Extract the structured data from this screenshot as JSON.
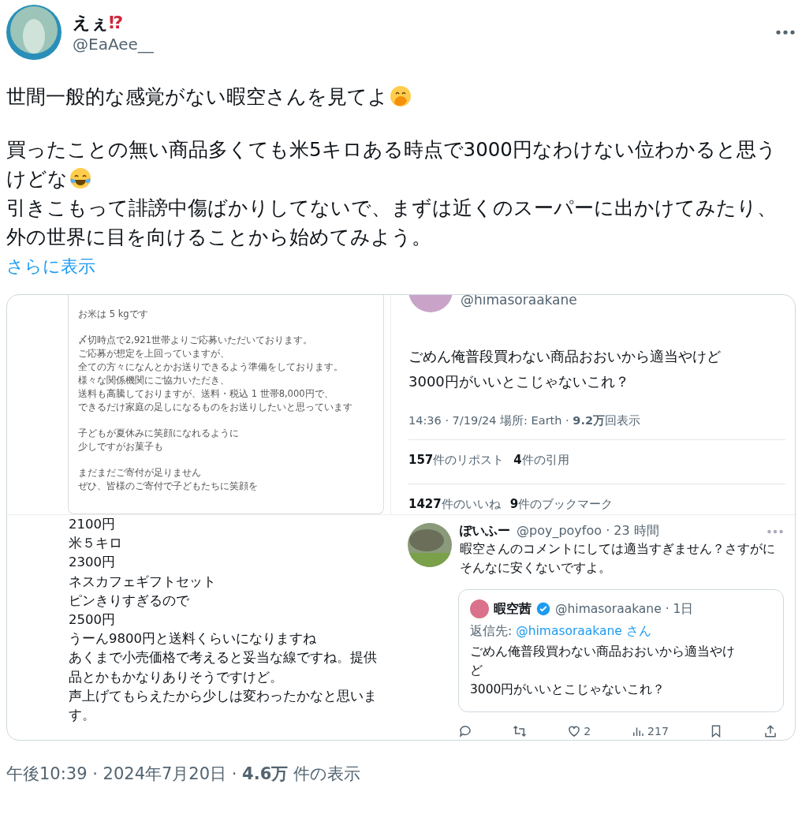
{
  "author": {
    "name": "えぇ",
    "mark": "⁉",
    "handle": "@EaAee__"
  },
  "paragraphs": [
    [
      {
        "text": "世間一般的な感覚がない暇空さんを見てよ",
        "kind": "emoji_end"
      }
    ],
    [
      {
        "text": "買ったことの無い商品多くても米5キロある時点で3000円なわけない位わかると思うけどな",
        "kind": "emoji_end"
      },
      {
        "text": "引きこもって誹謗中傷ばかりしてないで、まずは近くのスーパーに出かけてみたり、外の世界に目を向けることから始めてみよう。",
        "kind": "plain"
      }
    ]
  ],
  "show_more": "さらに表示",
  "media": [
    {
      "kind": "notice",
      "paragraphs": [
        [
          "お米は 5 kgです"
        ],
        [
          "〆切時点で2,921世帯よりご応募いただいております。",
          "ご応募が想定を上回っていますが、",
          "全ての方々になんとかお送りできるよう準備をしております。",
          "様々な関係機関にご協力いただき、",
          "送料も高騰しておりますが、送料・税込 1 世帯8,000円で、",
          "できるだけ家庭の足しになるものをお送りしたいと思っています"
        ],
        [
          "子どもが夏休みに笑顔になれるように",
          "少しですがお菓子も"
        ],
        [
          "まだまだご寄付が足りません",
          "ぜひ、皆様のご寄付で子どもたちに笑顔を"
        ]
      ]
    },
    {
      "kind": "tweet",
      "handle": "@himasoraakane",
      "lines": [
        "ごめん俺普段買わない商品おおいから適当やけど",
        "3000円がいいとこじゃないこれ？"
      ],
      "meta": "14:36 · 7/19/24 場所: Earth · **9.2万**回表示",
      "stat_rows": [
        [
          {
            "count": "157",
            "label": "件のリポスト"
          },
          {
            "count": "4",
            "label": "件の引用"
          }
        ],
        [
          {
            "count": "1427",
            "label": "件のいいね"
          },
          {
            "count": "9",
            "label": "件のブックマーク"
          }
        ]
      ]
    },
    {
      "kind": "memo",
      "lines": [
        "2100円",
        "米５キロ",
        "2300円",
        "ネスカフェギフトセット",
        "ピンきりすぎるので",
        "2500円",
        "うーん9800円と送料くらいになりますね",
        "あくまで小売価格で考えると妥当な線ですね。提供品とかもかなりありそうですけど。",
        "声上げてもらえたから少しは変わったかなと思います。"
      ]
    },
    {
      "kind": "reply",
      "name": "ぽいふー",
      "handle": "@poy_poyfoo · 23 時間",
      "text": "暇空さんのコメントにしては適当すぎません？さすがにそんなに安くないですよ。",
      "quote": {
        "name": "暇空茜",
        "verified": true,
        "handle": "@himasoraakane · 1日",
        "reply_label": "返信先:",
        "reply_to": "@himasoraakane さん",
        "lines": [
          "ごめん俺普段買わない商品おおいから適当やけ",
          "ど",
          "3000円がいいとこじゃないこれ？"
        ]
      },
      "actions": [
        {
          "kind": "reply"
        },
        {
          "kind": "repost"
        },
        {
          "kind": "like",
          "count": "2"
        },
        {
          "kind": "views",
          "count": "217"
        },
        {
          "kind": "bookmark"
        },
        {
          "kind": "share"
        }
      ]
    }
  ],
  "footer": "午後10:39 · 2024年7月20日 · **4.6万** 件の表示"
}
